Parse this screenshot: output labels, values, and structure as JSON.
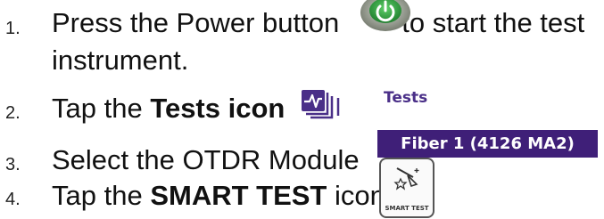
{
  "steps": [
    {
      "number": "1.",
      "text_before": "Press the Power button",
      "text_after": "to start the test",
      "line2": "instrument.",
      "icon": "power-button-icon"
    },
    {
      "number": "2.",
      "text_before": "Tap the ",
      "bold": "Tests icon",
      "icon": "tests-icon",
      "icon_label": "Tests"
    },
    {
      "number": "3.",
      "text": "Select the OTDR Module",
      "badge": "Fiber 1 (4126 MA2)"
    },
    {
      "number": "4.",
      "text_before": "Tap the ",
      "bold": "SMART TEST",
      "text_after": " icon",
      "icon": "smart-test-icon",
      "icon_label": "SMART TEST"
    }
  ],
  "colors": {
    "text": "#111111",
    "module_badge_bg": "#3f1f78",
    "tests_icon": "#4a2f88",
    "power_icon_green": "#3aa14a",
    "power_icon_gray": "#8a8f86"
  }
}
